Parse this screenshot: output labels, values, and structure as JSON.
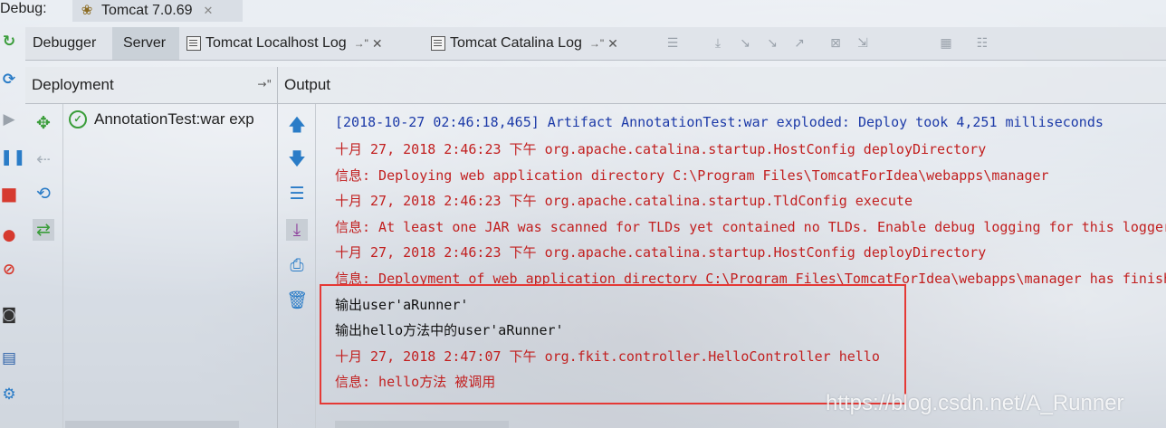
{
  "debug": {
    "label": "Debug:",
    "tab_title": "Tomcat 7.0.69",
    "tab_icon": "tomcat-icon"
  },
  "tabs": [
    {
      "label": "Debugger",
      "selected": false
    },
    {
      "label": "Server",
      "selected": true
    },
    {
      "label": "Tomcat Localhost Log",
      "selected": false
    },
    {
      "label": "Tomcat Catalina Log",
      "selected": false
    }
  ],
  "panels": {
    "deployment": {
      "title": "Deployment",
      "item": "AnnotationTest:war exp"
    },
    "output": {
      "title": "Output"
    }
  },
  "log_lines": [
    {
      "text": "[2018-10-27 02:46:18,465] Artifact AnnotationTest:war exploded: Deploy took 4,251 milliseconds",
      "color": "#1c3aa8"
    },
    {
      "text": "十月 27, 2018 2:46:23 下午 org.apache.catalina.startup.HostConfig deployDirectory",
      "color": "#c21f1f"
    },
    {
      "text": "信息: Deploying web application directory C:\\Program Files\\TomcatForIdea\\webapps\\manager",
      "color": "#c21f1f"
    },
    {
      "text": "十月 27, 2018 2:46:23 下午 org.apache.catalina.startup.TldConfig execute",
      "color": "#c21f1f"
    },
    {
      "text": "信息: At least one JAR was scanned for TLDs yet contained no TLDs. Enable debug logging for this logger",
      "color": "#c21f1f"
    },
    {
      "text": "十月 27, 2018 2:46:23 下午 org.apache.catalina.startup.HostConfig deployDirectory",
      "color": "#c21f1f"
    },
    {
      "text": "信息: Deployment of web application directory C:\\Program Files\\TomcatForIdea\\webapps\\manager has finished",
      "color": "#c21f1f"
    },
    {
      "text": "输出user'aRunner'",
      "color": "#111111"
    },
    {
      "text": "输出hello方法中的user'aRunner'",
      "color": "#111111"
    },
    {
      "text": "十月 27, 2018 2:47:07 下午 org.fkit.controller.HelloController hello",
      "color": "#c21f1f"
    },
    {
      "text": "信息: hello方法 被调用",
      "color": "#c21f1f"
    }
  ],
  "watermark": "https://blog.csdn.net/A_Runner",
  "colors": {
    "highlight_box": "#e53935",
    "info_red": "#c21f1f",
    "artifact_blue": "#1c3aa8"
  }
}
